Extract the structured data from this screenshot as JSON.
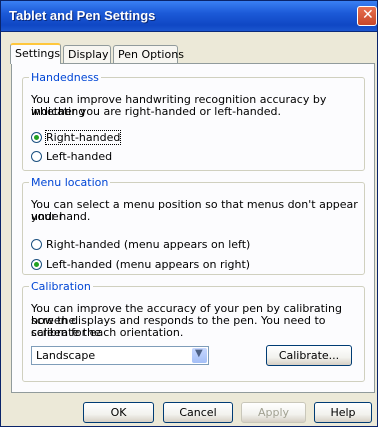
{
  "window": {
    "title": "Tablet and Pen Settings"
  },
  "tabs": [
    {
      "label": "Settings"
    },
    {
      "label": "Display"
    },
    {
      "label": "Pen Options"
    }
  ],
  "handedness": {
    "legend": "Handedness",
    "description_line1": "You can improve handwriting recognition accuracy by indicating",
    "description_line2": "whether you are right-handed or left-handed.",
    "option_right": "Right-handed",
    "option_left": "Left-handed",
    "selected": "Right-handed"
  },
  "menu_location": {
    "legend": "Menu location",
    "description_line1": "You can select a menu position so that menus don't appear under",
    "description_line2": "your hand.",
    "option_right": "Right-handed (menu appears on left)",
    "option_left": "Left-handed (menu appears on right)",
    "selected": "Left-handed (menu appears on right)"
  },
  "calibration": {
    "legend": "Calibration",
    "description_line1": "You can improve the accuracy of your pen by calibrating how the",
    "description_line2": "screen displays and responds to the pen. You need to calibrate the",
    "description_line3": "screen for each orientation.",
    "orientation_value": "Landscape",
    "calibrate_label": "Calibrate..."
  },
  "buttons": {
    "ok": "OK",
    "cancel": "Cancel",
    "apply": "Apply",
    "help": "Help"
  }
}
